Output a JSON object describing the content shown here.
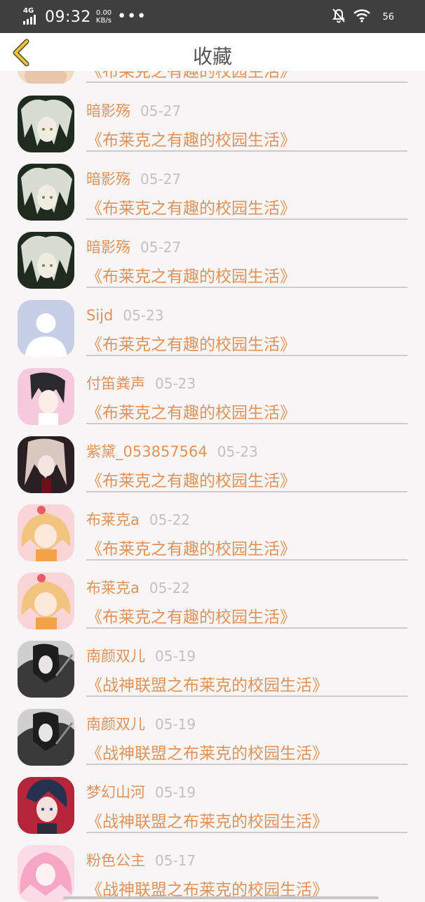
{
  "status_bar": {
    "network": "4G",
    "time": "09:32",
    "speed_value": "0.00",
    "speed_unit": "KB/s",
    "more": "•••",
    "battery": "56"
  },
  "header": {
    "title": "收藏"
  },
  "items": [
    {
      "user": "",
      "date": "",
      "book": "《布莱克之有趣的校园生活》",
      "avatar": "skin"
    },
    {
      "user": "暗影殇",
      "date": "05-27",
      "book": "《布莱克之有趣的校园生活》",
      "avatar": "silver"
    },
    {
      "user": "暗影殇",
      "date": "05-27",
      "book": "《布莱克之有趣的校园生活》",
      "avatar": "silver"
    },
    {
      "user": "暗影殇",
      "date": "05-27",
      "book": "《布莱克之有趣的校园生活》",
      "avatar": "silver"
    },
    {
      "user": "Sijd",
      "date": "05-23",
      "book": "《布莱克之有趣的校园生活》",
      "avatar": "default"
    },
    {
      "user": "付笛粪声",
      "date": "05-23",
      "book": "《布莱克之有趣的校园生活》",
      "avatar": "pinkboy"
    },
    {
      "user": "紫黛_053857564",
      "date": "05-23",
      "book": "《布莱克之有趣的校园生活》",
      "avatar": "dark"
    },
    {
      "user": "布莱克a",
      "date": "05-22",
      "book": "《布莱克之有趣的校园生活》",
      "avatar": "blonde"
    },
    {
      "user": "布莱克a",
      "date": "05-22",
      "book": "《布莱克之有趣的校园生活》",
      "avatar": "blonde"
    },
    {
      "user": "南颜双儿",
      "date": "05-19",
      "book": "《战神联盟之布莱克的校园生活》",
      "avatar": "ink"
    },
    {
      "user": "南颜双儿",
      "date": "05-19",
      "book": "《战神联盟之布莱克的校园生活》",
      "avatar": "ink"
    },
    {
      "user": "梦幻山河",
      "date": "05-19",
      "book": "《战神联盟之布莱克的校园生活》",
      "avatar": "red"
    },
    {
      "user": "粉色公主",
      "date": "05-17",
      "book": "《战神联盟之布莱克的校园生活》",
      "avatar": "pink"
    }
  ],
  "colors": {
    "accent": "#e0925a",
    "date": "#c4c0c0",
    "background": "#f7f5f6",
    "status_bar": "#3f3f3f",
    "back_icon": "#e8c73b"
  }
}
